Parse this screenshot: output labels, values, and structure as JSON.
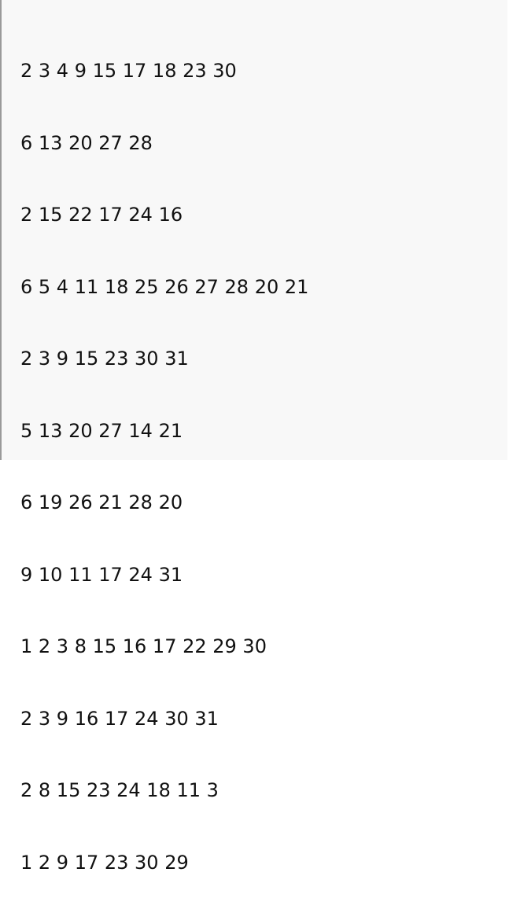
{
  "output": {
    "lines": [
      "2 3 4 9 15 17 18 23 30",
      "6 13 20 27 28",
      "2 15 22 17 24 16",
      "6 5 4 11 18 25 26 27 28 20 21",
      "2 3 9 15 23 30 31",
      "5 13 20 27 14 21",
      "6 19 26 21 28 20",
      "9 10 11 17 24 31",
      "1 2 3 8 15 16 17 22 29 30",
      "2 3 9 16 17 24 30 31",
      "2 8 15 23 24 18 11 3",
      "1 2 9 17 23 30 29"
    ]
  }
}
